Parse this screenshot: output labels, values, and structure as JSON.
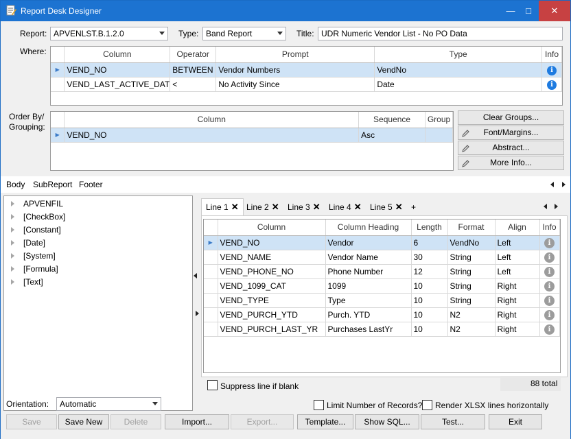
{
  "window": {
    "title": "Report Desk Designer",
    "minimize": "—",
    "maximize": "□",
    "close": "✕"
  },
  "header": {
    "report_label": "Report:",
    "report_value": "APVENLST.B.1.2.0",
    "type_label": "Type:",
    "type_value": "Band Report",
    "title_label": "Title:",
    "title_value": "UDR Numeric Vendor List - No PO Data"
  },
  "where": {
    "label": "Where:",
    "columns": [
      "Column",
      "Operator",
      "Prompt",
      "Type",
      "Info"
    ],
    "rows": [
      {
        "column": "VEND_NO",
        "operator": "BETWEEN",
        "prompt": "Vendor Numbers",
        "type": "VendNo",
        "info": "i"
      },
      {
        "column": "VEND_LAST_ACTIVE_DAT",
        "operator": "<",
        "prompt": "No Activity Since",
        "type": "Date",
        "info": "i"
      }
    ]
  },
  "order": {
    "label_line1": "Order By/",
    "label_line2": "Grouping:",
    "columns": [
      "Column",
      "Sequence",
      "Group"
    ],
    "rows": [
      {
        "column": "VEND_NO",
        "sequence": "Asc",
        "group": ""
      }
    ]
  },
  "side_buttons": [
    "Clear Groups...",
    "Font/Margins...",
    "Abstract...",
    "More Info..."
  ],
  "section_tabs": [
    "Body",
    "SubReport",
    "Footer"
  ],
  "tree": [
    "APVENFIL",
    "[CheckBox]",
    "[Constant]",
    "[Date]",
    "[System]",
    "[Formula]",
    "[Text]"
  ],
  "line_tabs": [
    "Line 1",
    "Line 2",
    "Line 3",
    "Line 4",
    "Line 5",
    "+"
  ],
  "line_grid": {
    "columns": [
      "Column",
      "Column Heading",
      "Length",
      "Format",
      "Align",
      "Info"
    ],
    "rows": [
      {
        "column": "VEND_NO",
        "heading": "Vendor",
        "length": "6",
        "format": "VendNo",
        "align": "Left",
        "info": "i"
      },
      {
        "column": "VEND_NAME",
        "heading": "Vendor Name",
        "length": "30",
        "format": "String",
        "align": "Left",
        "info": "i"
      },
      {
        "column": "VEND_PHONE_NO",
        "heading": "Phone Number",
        "length": "12",
        "format": "String",
        "align": "Left",
        "info": "i"
      },
      {
        "column": "VEND_1099_CAT",
        "heading": "1099",
        "length": "10",
        "format": "String",
        "align": "Right",
        "info": "i"
      },
      {
        "column": "VEND_TYPE",
        "heading": "Type",
        "length": "10",
        "format": "String",
        "align": "Right",
        "info": "i"
      },
      {
        "column": "VEND_PURCH_YTD",
        "heading": "Purch. YTD",
        "length": "10",
        "format": "N2",
        "align": "Right",
        "info": "i"
      },
      {
        "column": "VEND_PURCH_LAST_YR",
        "heading": "Purchases LastYr",
        "length": "10",
        "format": "N2",
        "align": "Right",
        "info": "i"
      }
    ]
  },
  "suppress_label": "Suppress line if blank",
  "total": "88 total",
  "orientation_label": "Orientation:",
  "orientation_value": "Automatic",
  "limit_label": "Limit Number of Records?",
  "xlsx_label": "Render XLSX lines horizontally",
  "bottom_buttons": {
    "save": "Save",
    "save_new": "Save New",
    "delete": "Delete",
    "import": "Import...",
    "export": "Export...",
    "template": "Template...",
    "show_sql": "Show SQL...",
    "test": "Test...",
    "exit": "Exit"
  }
}
